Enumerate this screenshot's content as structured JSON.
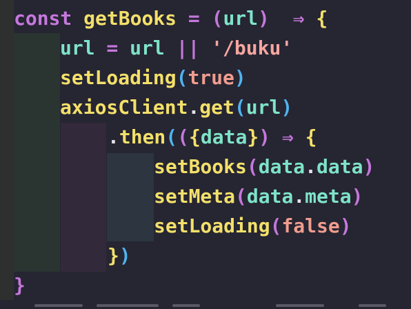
{
  "editor": {
    "lines": [
      {
        "tokens": [
          {
            "t": "const",
            "c": "kw"
          },
          {
            "t": " ",
            "c": "plain"
          },
          {
            "t": "getBooks",
            "c": "fn"
          },
          {
            "t": " = ",
            "c": "op"
          },
          {
            "t": "(",
            "c": "par"
          },
          {
            "t": "url",
            "c": "var"
          },
          {
            "t": ")",
            "c": "par"
          },
          {
            "t": "  ⇒ ",
            "c": "op"
          },
          {
            "t": "{",
            "c": "br1"
          }
        ]
      },
      {
        "tokens": [
          {
            "t": "url",
            "c": "var"
          },
          {
            "t": " = ",
            "c": "op"
          },
          {
            "t": "url",
            "c": "var"
          },
          {
            "t": " || ",
            "c": "op"
          },
          {
            "t": "'/buku'",
            "c": "str"
          }
        ]
      },
      {
        "tokens": [
          {
            "t": "setLoading",
            "c": "fn"
          },
          {
            "t": "(",
            "c": "br3"
          },
          {
            "t": "true",
            "c": "bool"
          },
          {
            "t": ")",
            "c": "br3"
          }
        ]
      },
      {
        "tokens": [
          {
            "t": "axiosClient",
            "c": "fn"
          },
          {
            "t": ".",
            "c": "plain"
          },
          {
            "t": "get",
            "c": "fn"
          },
          {
            "t": "(",
            "c": "br3"
          },
          {
            "t": "url",
            "c": "var"
          },
          {
            "t": ")",
            "c": "br3"
          }
        ]
      },
      {
        "tokens": [
          {
            "t": ".",
            "c": "plain"
          },
          {
            "t": "then",
            "c": "fn"
          },
          {
            "t": "(",
            "c": "br3"
          },
          {
            "t": "(",
            "c": "br2"
          },
          {
            "t": "{",
            "c": "br1"
          },
          {
            "t": "data",
            "c": "var"
          },
          {
            "t": "}",
            "c": "br1"
          },
          {
            "t": ")",
            "c": "br2"
          },
          {
            "t": " ⇒ ",
            "c": "op"
          },
          {
            "t": "{",
            "c": "br1"
          }
        ]
      },
      {
        "tokens": [
          {
            "t": "setBooks",
            "c": "fn"
          },
          {
            "t": "(",
            "c": "br2"
          },
          {
            "t": "data",
            "c": "var"
          },
          {
            "t": ".",
            "c": "plain"
          },
          {
            "t": "data",
            "c": "var"
          },
          {
            "t": ")",
            "c": "br2"
          }
        ]
      },
      {
        "tokens": [
          {
            "t": "setMeta",
            "c": "fn"
          },
          {
            "t": "(",
            "c": "br2"
          },
          {
            "t": "data",
            "c": "var"
          },
          {
            "t": ".",
            "c": "plain"
          },
          {
            "t": "meta",
            "c": "var"
          },
          {
            "t": ")",
            "c": "br2"
          }
        ]
      },
      {
        "tokens": [
          {
            "t": "setLoading",
            "c": "fn"
          },
          {
            "t": "(",
            "c": "br2"
          },
          {
            "t": "false",
            "c": "bool"
          },
          {
            "t": ")",
            "c": "br2"
          }
        ]
      },
      {
        "tokens": [
          {
            "t": "}",
            "c": "br1"
          },
          {
            "t": ")",
            "c": "br3"
          }
        ]
      },
      {
        "tokens": [
          {
            "t": "}",
            "c": "kw"
          }
        ]
      }
    ]
  },
  "colors": {
    "background": "#262532",
    "keyword": "#c678dd",
    "function": "#f3e06a",
    "variable": "#7ee3c8",
    "string": "#f5a6a0",
    "boolean": "#f09d8e",
    "bracket_blue": "#4fb3f0"
  }
}
